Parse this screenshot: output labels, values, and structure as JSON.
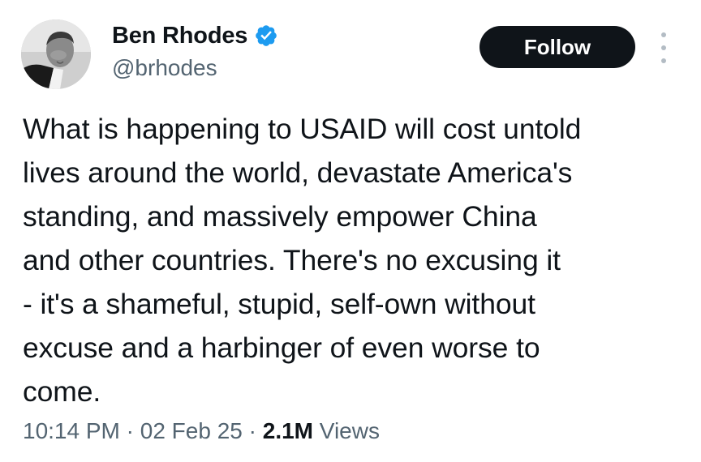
{
  "author": {
    "name": "Ben Rhodes",
    "handle": "@brhodes",
    "verified": true,
    "verified_color": "#1d9bf0"
  },
  "actions": {
    "follow_label": "Follow",
    "more_icon": "more-vertical-icon"
  },
  "tweet": {
    "lines": [
      "What is happening to USAID will cost untold",
      "lives around the world, devastate America's",
      "standing, and massively empower China",
      "and other countries. There's no excusing it",
      "- it's a shameful, stupid, self-own without",
      "excuse and a harbinger of even worse to",
      "come."
    ]
  },
  "meta": {
    "time": "10:14 PM",
    "separator": " · ",
    "date": "02 Feb 25",
    "views_count": "2.1M",
    "views_label": " Views"
  }
}
